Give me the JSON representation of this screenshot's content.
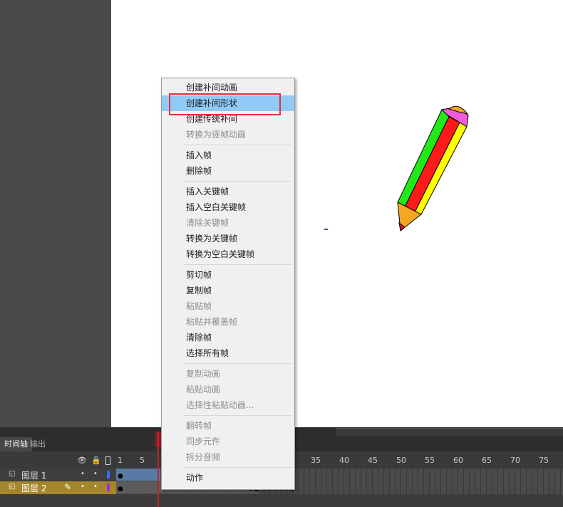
{
  "timeline": {
    "tabs": [
      "时间轴",
      "输出"
    ],
    "header_icons": {
      "eye": "eye-icon",
      "lock": "lock-icon",
      "outline": "outline-icon"
    },
    "ruler_labels": [
      "1",
      "5",
      "35",
      "40",
      "45",
      "50",
      "55",
      "60",
      "65",
      "70",
      "75"
    ],
    "layers": [
      {
        "name": "图层 1",
        "color": "#3b6cff",
        "selected": false
      },
      {
        "name": "图层 2",
        "color": "#9b30d0",
        "selected": true
      }
    ]
  },
  "context_menu": {
    "items": [
      {
        "label": "创建补间动画",
        "enabled": true
      },
      {
        "label": "创建补间形状",
        "enabled": true,
        "highlighted": true
      },
      {
        "label": "创建传统补间",
        "enabled": true
      },
      {
        "label": "转换为逐帧动画",
        "enabled": false
      },
      {
        "label": "插入帧",
        "enabled": true
      },
      {
        "label": "删除帧",
        "enabled": true
      },
      {
        "label": "插入关键帧",
        "enabled": true
      },
      {
        "label": "插入空白关键帧",
        "enabled": true
      },
      {
        "label": "清除关键帧",
        "enabled": false
      },
      {
        "label": "转换为关键帧",
        "enabled": true
      },
      {
        "label": "转换为空白关键帧",
        "enabled": true
      },
      {
        "label": "剪切帧",
        "enabled": true
      },
      {
        "label": "复制帧",
        "enabled": true
      },
      {
        "label": "粘贴帧",
        "enabled": false
      },
      {
        "label": "粘贴并覆盖帧",
        "enabled": false
      },
      {
        "label": "清除帧",
        "enabled": true
      },
      {
        "label": "选择所有帧",
        "enabled": true
      },
      {
        "label": "复制动画",
        "enabled": false
      },
      {
        "label": "粘贴动画",
        "enabled": false
      },
      {
        "label": "选择性粘贴动画...",
        "enabled": false
      },
      {
        "label": "翻转帧",
        "enabled": false
      },
      {
        "label": "同步元件",
        "enabled": false
      },
      {
        "label": "拆分音频",
        "enabled": false
      },
      {
        "label": "动作",
        "enabled": true
      }
    ]
  },
  "colors": {
    "highlight": "#91c9f7",
    "annotation_box": "#e53238",
    "active_layer": "#a5862c",
    "pencil_green": "#22e81a",
    "pencil_red": "#ff1a1a",
    "pencil_yellow": "#ffff00",
    "pencil_eraser": "#f05adb",
    "pencil_tip": "#f5a623"
  }
}
